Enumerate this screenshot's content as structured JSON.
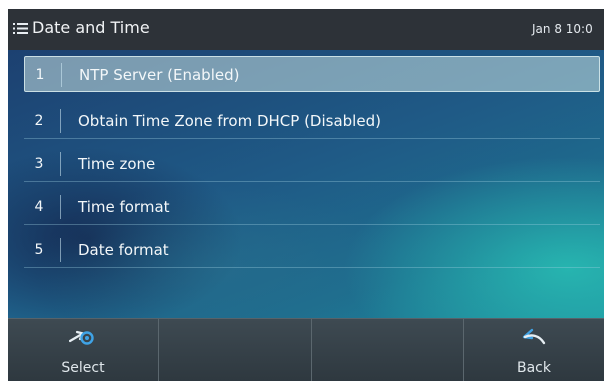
{
  "header": {
    "menu_icon": "menu-list-icon",
    "title": "Date and Time",
    "datetime": "Jan 8 10:0"
  },
  "menu": {
    "selected_index": 0,
    "items": [
      {
        "number": "1",
        "label": "NTP Server (Enabled)"
      },
      {
        "number": "2",
        "label": "Obtain Time Zone from DHCP (Disabled)"
      },
      {
        "number": "3",
        "label": "Time zone"
      },
      {
        "number": "4",
        "label": "Time format"
      },
      {
        "number": "5",
        "label": "Date format"
      }
    ]
  },
  "softkeys": [
    {
      "label": "Select",
      "icon": "select-arrow-icon"
    },
    {
      "label": "",
      "icon": ""
    },
    {
      "label": "",
      "icon": ""
    },
    {
      "label": "Back",
      "icon": "back-arrow-icon"
    }
  ],
  "colors": {
    "status_bar": "#2d3238",
    "selected_row": "#c8e1e1",
    "accent_icon": "#3fa3e6",
    "softkey_bar": "#3e4a52"
  }
}
